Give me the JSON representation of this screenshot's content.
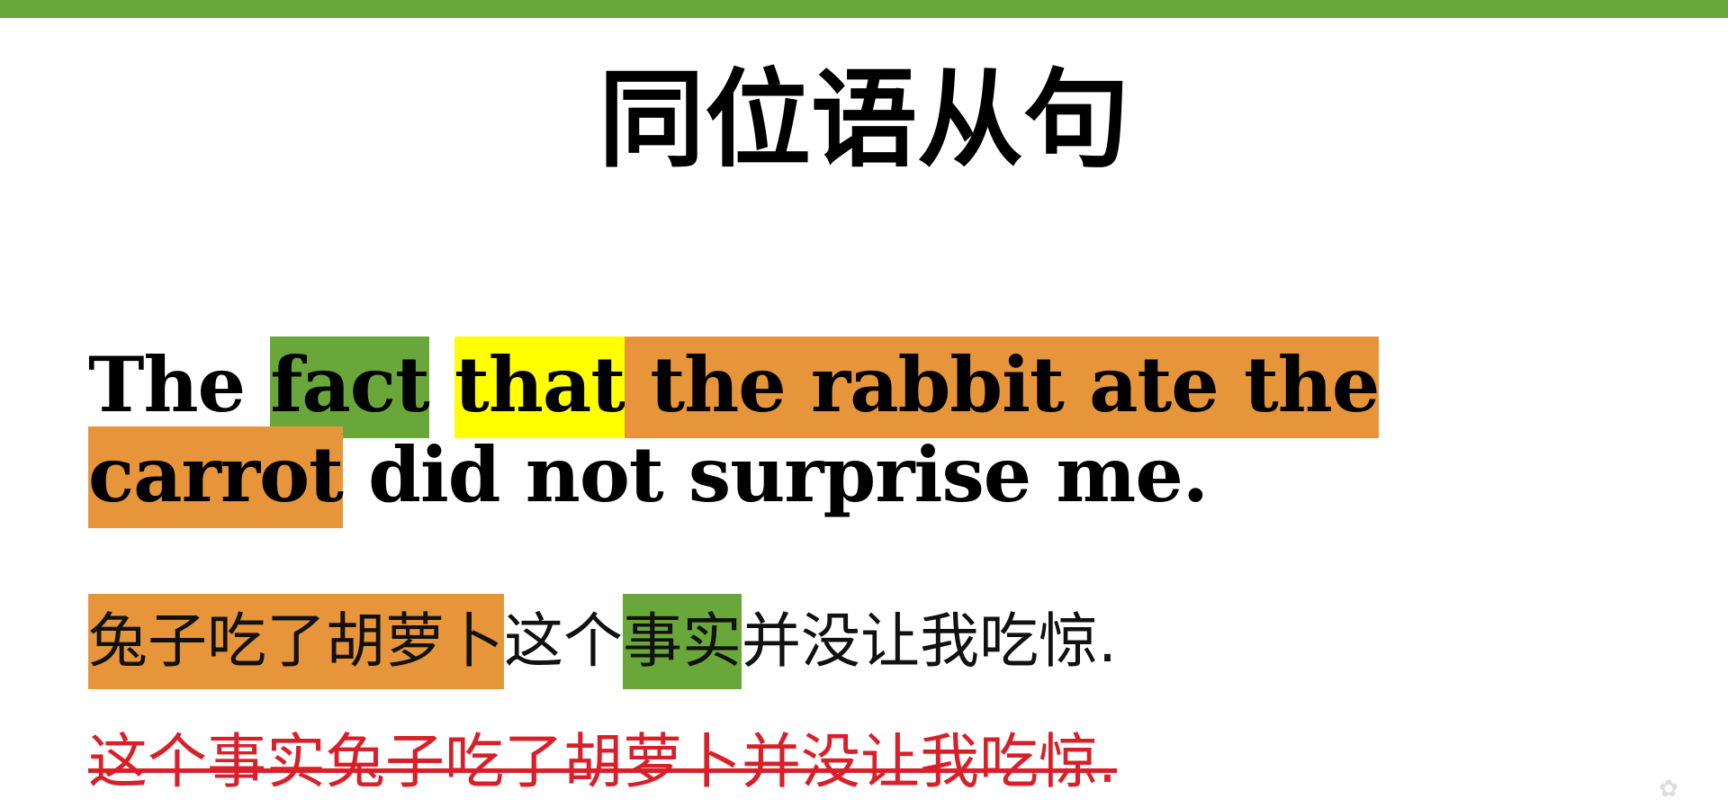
{
  "header": {
    "accent_color": "#6aa73a"
  },
  "title": "同位语从句",
  "sentence": {
    "p1": "The ",
    "fact": "fact",
    "gap": " ",
    "that": "that",
    "clause": " the rabbit ate the carrot",
    "rest": " did not surprise me."
  },
  "chinese": {
    "clause": "兔子吃了胡萝卜",
    "p2": "这个",
    "noun": "事实",
    "p3": "并没让我吃惊."
  },
  "wrong_example": "这个事实兔子吃了胡萝卜并没让我吃惊.",
  "colors": {
    "noun_highlight": "#6aa73a",
    "that_highlight": "#ffff00",
    "clause_highlight": "#e6953a",
    "wrong_text": "#d8202a"
  }
}
